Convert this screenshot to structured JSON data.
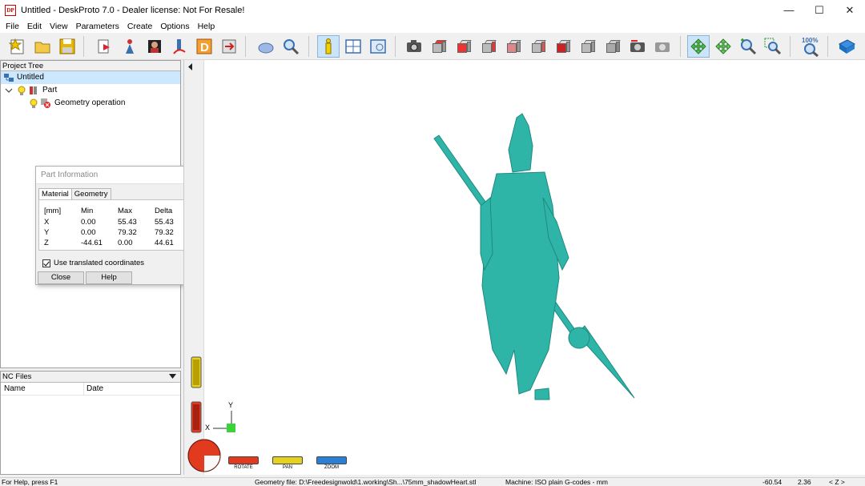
{
  "window": {
    "title": "Untitled - DeskProto 7.0 - Dealer license: Not For Resale!",
    "app_icon": "DP",
    "controls": [
      "—",
      "☐",
      "✕"
    ]
  },
  "menu": [
    "File",
    "Edit",
    "View",
    "Parameters",
    "Create",
    "Options",
    "Help"
  ],
  "toolbar": {
    "zoom_label": "100%"
  },
  "project_tree": {
    "header": "Project Tree",
    "root": "Untitled",
    "part": "Part",
    "operation": "Geometry operation"
  },
  "nc_files": {
    "header": "NC Files",
    "columns": [
      "Name",
      "Date"
    ]
  },
  "part_info": {
    "title": "Part Information",
    "tabs": [
      "Material",
      "Geometry"
    ],
    "columns": [
      "[mm]",
      "Min",
      "Max",
      "Delta"
    ],
    "rows": [
      {
        "axis": "X",
        "min": "0.00",
        "max": "55.43",
        "delta": "55.43"
      },
      {
        "axis": "Y",
        "min": "0.00",
        "max": "79.32",
        "delta": "79.32"
      },
      {
        "axis": "Z",
        "min": "-44.61",
        "max": "0.00",
        "delta": "44.61"
      }
    ],
    "checkbox_label": "Use translated coordinates",
    "close_label": "Close",
    "help_label": "Help"
  },
  "viewport": {
    "axis_y": "Y",
    "axis_x": "X",
    "controls": {
      "rotate": "ROTATE",
      "pan": "PAN",
      "zoom": "ZOOM"
    },
    "colors": {
      "model": "#2fb5a8",
      "rotate": "#e23a1f",
      "pan": "#e6d020",
      "zoom": "#2d7fd6"
    }
  },
  "status": {
    "help": "For Help, press F1",
    "geometry": "Geometry file: D:\\Freedesignwold\\1.working\\Sh...\\75mm_shadowHeart.stl",
    "machine": "Machine: ISO plain G-codes - mm",
    "coord_x": "-60.54",
    "coord_y": "2.36",
    "axis": "< Z >"
  }
}
